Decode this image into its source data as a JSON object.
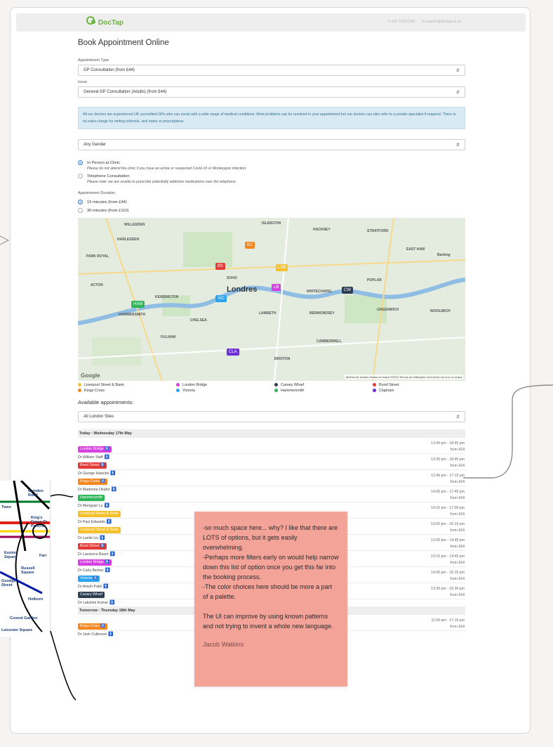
{
  "header": {
    "brand": "DocTap",
    "phone": "020 7183 0200",
    "email": "support@doctap.co.uk"
  },
  "page_title": "Book Appointment Online",
  "form": {
    "appointment_type_label": "Appointment Type",
    "appointment_type_value": "GP Consultation (from £44)",
    "issue_label": "Issue",
    "issue_value": "General GP Consultation (Adults) (from £44)",
    "info_text": "All our doctors are experienced UK accredited GPs who can assist with a wide range of medical conditions. Most problems can be resolved in your appointment but our doctors can also refer to a private specialist if required. There is no extra charge for writing referrals, sick notes or prescriptions.",
    "gender_value": "Any Gender",
    "consult_options": [
      {
        "label": "In Person at Clinic",
        "note": "Please do not attend the clinic if you have an active or suspected Covid-19 or Monkeypox infection.",
        "selected": true
      },
      {
        "label": "Telephone Consultation",
        "note": "Please note: we are unable to prescribe potentially addictive medications over the telephone.",
        "selected": false
      }
    ],
    "duration_label": "Appointment Duration",
    "duration_options": [
      {
        "label": "15 minutes (from £44)",
        "selected": true
      },
      {
        "label": "30 minutes (from £110)",
        "selected": false
      }
    ]
  },
  "map": {
    "city_label": "Londres",
    "google": "Google",
    "footer": "Atalhos de teclado   Dados do mapa ©2023   Termos de Utilização   Comunicar um erro no mapa",
    "areas": [
      "WILLESDEN",
      "HARLESDEN",
      "PARK ROYAL",
      "ACTON",
      "HACKNEY",
      "STRATFORD",
      "ISLINGTON",
      "SOHO",
      "KENSINGTON",
      "HAMMERSMITH",
      "CHELSEA",
      "FULHAM",
      "LAMBETH",
      "BERMONDSEY",
      "WHITECHAPEL",
      "POPLAR",
      "GREENWICH",
      "CAMBERWELL",
      "BRIXTON",
      "WOOLWICH",
      "EAST HAM",
      "Barking"
    ],
    "pins": [
      {
        "code": "KC",
        "color": "#f5861f"
      },
      {
        "code": "BS",
        "color": "#e53935"
      },
      {
        "code": "LSB",
        "color": "#f6c02b"
      },
      {
        "code": "LB",
        "color": "#d63fe0"
      },
      {
        "code": "CW",
        "color": "#2d3e50"
      },
      {
        "code": "VIC",
        "color": "#29a3f0"
      },
      {
        "code": "HAM",
        "color": "#2fb55a"
      },
      {
        "code": "CLA",
        "color": "#6a2fd6"
      }
    ]
  },
  "legend": [
    {
      "name": "Liverpool Street & Bank",
      "color": "#f6c02b"
    },
    {
      "name": "London Bridge",
      "color": "#d63fe0"
    },
    {
      "name": "Canary Wharf",
      "color": "#2d3e50"
    },
    {
      "name": "Bond Street",
      "color": "#e53935"
    },
    {
      "name": "Kings Cross",
      "color": "#f5861f"
    },
    {
      "name": "Victoria",
      "color": "#29a3f0"
    },
    {
      "name": "Hammersmith",
      "color": "#2fb55a"
    },
    {
      "name": "Clapham",
      "color": "#6a2fd6"
    }
  ],
  "available": {
    "title": "Available appointments:",
    "site_filter": "All London Sites",
    "days": [
      {
        "heading": "Today - Wednesday 17th May",
        "appointments": [
          {
            "site": "London Bridge ♿",
            "color": "#d63fe0",
            "doctor": "Dr William Staff",
            "gender": "m",
            "time": "13:45 pm - 18:45 pm",
            "price": "from £64"
          },
          {
            "site": "Bond Street ♿",
            "color": "#e53935",
            "doctor": "Dr George Hawche",
            "gender": "m",
            "time": "13:30 pm - 18:45 pm",
            "price": "from £64"
          },
          {
            "site": "Kings Cross ♿",
            "color": "#f5861f",
            "doctor": "Dr Madonna Okafor",
            "gender": "f",
            "time": "12:45 pm - 17:15 pm",
            "price": "from £64"
          },
          {
            "site": "Hammersmith",
            "color": "#2fb55a",
            "doctor": "Dr Mengyan Lu",
            "gender": "f",
            "time": "14:00 pm - 17:45 pm",
            "price": "from £64"
          },
          {
            "site": "Liverpool Street & Bank",
            "color": "#f6c02b",
            "doctor": "Dr Paul Edwards",
            "gender": "m",
            "time": "14:15 pm - 17:00 pm",
            "price": "from £64"
          },
          {
            "site": "Liverpool Street & Bank",
            "color": "#f6c02b",
            "doctor": "Dr Lanlin Liu",
            "gender": "f",
            "time": "13:00 pm - 16:15 pm",
            "price": "from £64"
          },
          {
            "site": "Bond Street ♿",
            "color": "#e53935",
            "doctor": "Dr Laurence Baum",
            "gender": "m",
            "time": "13:00 pm - 14:45 pm",
            "price": "from £64"
          },
          {
            "site": "London Bridge ♿",
            "color": "#d63fe0",
            "doctor": "Dr Carly Becker",
            "gender": "f",
            "time": "13:15 pm - 14:45 pm",
            "price": "from £64"
          },
          {
            "site": "Victoria ♿",
            "color": "#29a3f0",
            "doctor": "Dr Amish Patel",
            "gender": "m",
            "time": "14:00 pm - 16:15 pm",
            "price": "from £64"
          },
          {
            "site": "Canary Wharf",
            "color": "#2d3e50",
            "doctor": "Dr Lakshmi Kumar",
            "gender": "f",
            "time": "13:30 pm - 15:30 pm",
            "price": "from £64"
          }
        ]
      },
      {
        "heading": "Tomorrow - Thursday 18th May",
        "appointments": [
          {
            "site": "Kings Cross ♿",
            "color": "#f5861f",
            "doctor": "Dr Josh Cullimore",
            "gender": "m",
            "time": "11:00 am - 17:15 pm",
            "price": "from £64"
          }
        ]
      }
    ]
  },
  "sticky_note": {
    "text": "-so much space here... why? I like that there are LOTS of options, but it gets easily overwhelming.\n-Perhaps more filters early on would help narrow down this list of option once you get this far into the booking process.\n-The color choices here should be more a part of a palette.\n\nThe UI can improve by using known patterns and not trying to invent a whole new language.",
    "author": "Jacob Watkins"
  },
  "tube_map": {
    "stations": [
      "Camden Road",
      "Town",
      "King's Cross St. Pancras",
      "Euston Square",
      "Russell Square",
      "Farr",
      "Goodge Street",
      "Holborn",
      "Covent Garden",
      "Leicester Square"
    ]
  }
}
